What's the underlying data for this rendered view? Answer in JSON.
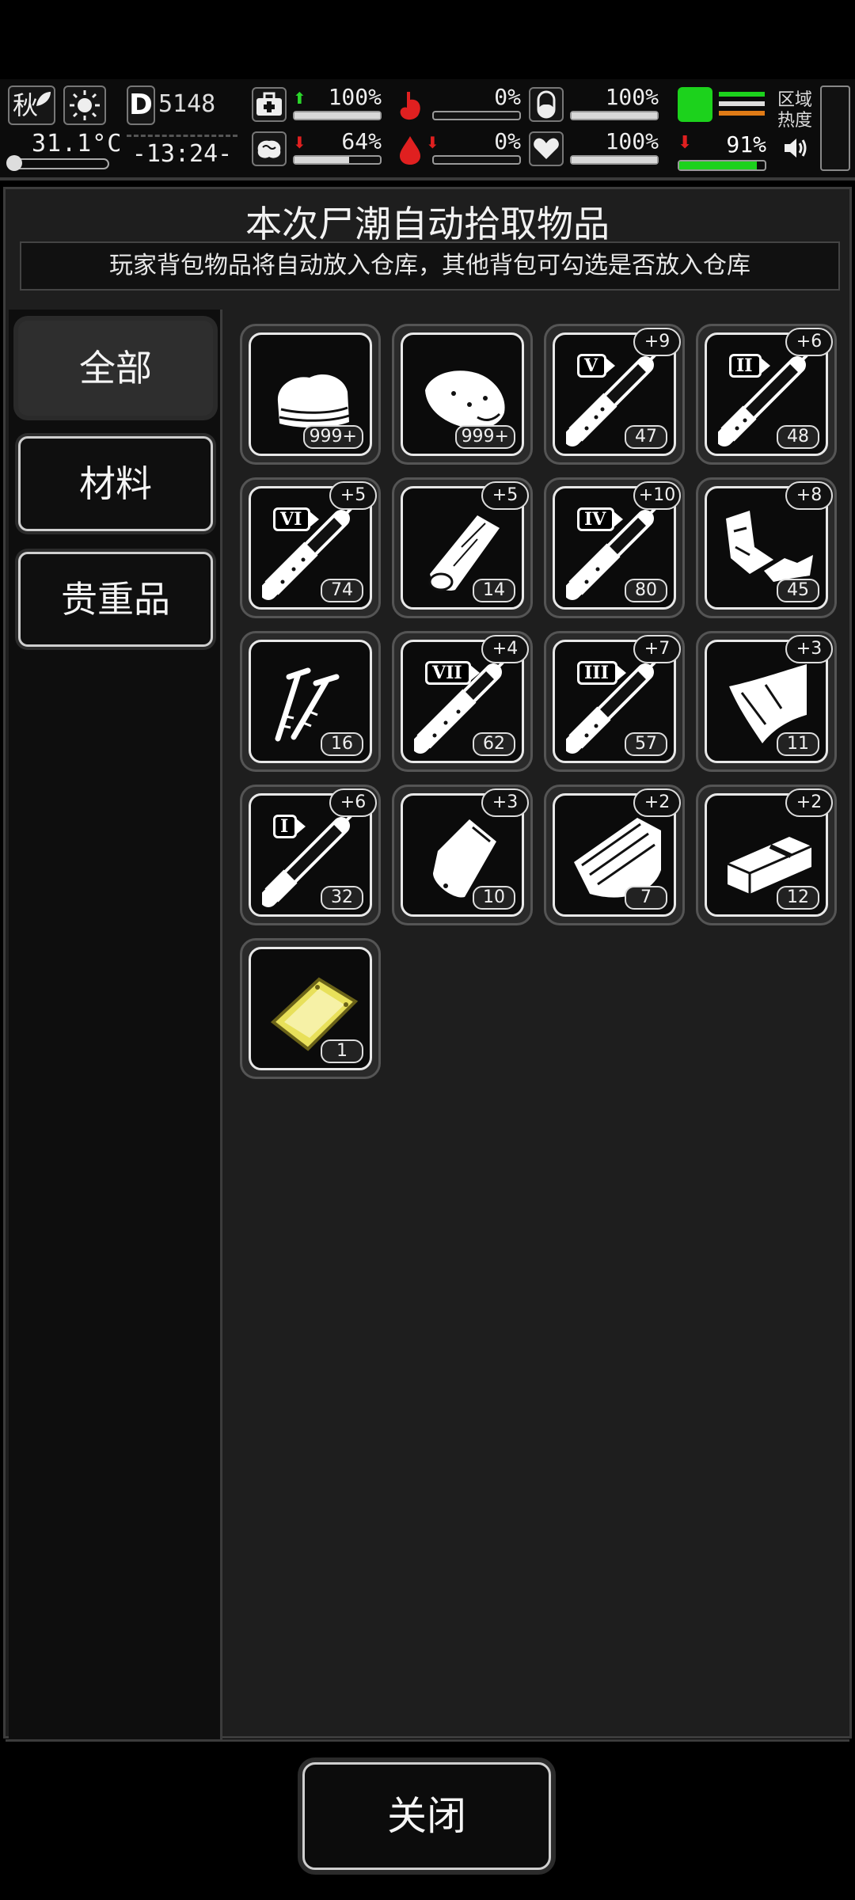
{
  "status": {
    "season": "秋",
    "temperature": "31.1°C",
    "day": "5148",
    "day_prefix": "D",
    "time": "-13:24-",
    "stats": [
      {
        "name": "health",
        "icon": "medkit-icon",
        "trend": "up",
        "value": "100%",
        "fill": 1.0
      },
      {
        "name": "hunger",
        "icon": "stomach-icon",
        "trend": "none",
        "value": "0%",
        "fill": 0.0
      },
      {
        "name": "fatigue",
        "icon": "pill-icon",
        "trend": "none",
        "value": "100%",
        "fill": 1.0
      },
      {
        "name": "mental",
        "icon": "brain-icon",
        "trend": "down",
        "value": "64%",
        "fill": 0.64
      },
      {
        "name": "bleeding",
        "icon": "blood-drop-icon",
        "trend": "down",
        "value": "0%",
        "fill": 0.0
      },
      {
        "name": "mood",
        "icon": "heart-icon",
        "trend": "none",
        "value": "100%",
        "fill": 1.0
      }
    ],
    "weather": {
      "trend": "down",
      "value": "91%",
      "fill": 0.91
    },
    "region_label_1": "区域",
    "region_label_2": "热度"
  },
  "panel": {
    "title": "本次尸潮自动拾取物品",
    "subtitle": "玩家背包物品将自动放入仓库，其他背包可勾选是否放入仓库",
    "tabs": [
      {
        "label": "全部",
        "active": true
      },
      {
        "label": "材料",
        "active": false
      },
      {
        "label": "贵重品",
        "active": false
      }
    ],
    "items": [
      {
        "icon": "cloth-icon",
        "count": "999+",
        "bonus": ""
      },
      {
        "icon": "meat-icon",
        "count": "999+",
        "bonus": ""
      },
      {
        "icon": "syringe-v-icon",
        "roman": "V",
        "count": "47",
        "bonus": "+9"
      },
      {
        "icon": "syringe-ii-icon",
        "roman": "II",
        "count": "48",
        "bonus": "+6"
      },
      {
        "icon": "syringe-vi-icon",
        "roman": "VI",
        "count": "74",
        "bonus": "+5"
      },
      {
        "icon": "wood-plank-icon",
        "count": "14",
        "bonus": "+5"
      },
      {
        "icon": "syringe-iv-icon",
        "roman": "IV",
        "count": "80",
        "bonus": "+10"
      },
      {
        "icon": "scrap-metal-icon",
        "count": "45",
        "bonus": "+8"
      },
      {
        "icon": "screws-icon",
        "count": "16",
        "bonus": ""
      },
      {
        "icon": "syringe-vii-icon",
        "roman": "VII",
        "count": "62",
        "bonus": "+4"
      },
      {
        "icon": "syringe-iii-icon",
        "roman": "III",
        "count": "57",
        "bonus": "+7"
      },
      {
        "icon": "iron-sheet-icon",
        "count": "11",
        "bonus": "+3"
      },
      {
        "icon": "syringe-i-icon",
        "roman": "I",
        "count": "32",
        "bonus": "+6"
      },
      {
        "icon": "plastic-bag-icon",
        "count": "10",
        "bonus": "+3"
      },
      {
        "icon": "lumber-icon",
        "count": "7",
        "bonus": "+2"
      },
      {
        "icon": "brick-icon",
        "count": "12",
        "bonus": "+2"
      },
      {
        "icon": "gold-bar-icon",
        "count": "1",
        "bonus": ""
      }
    ],
    "close_label": "关闭"
  },
  "colors": {
    "accent_green": "#1cd21c",
    "alert_red": "#e02020",
    "gold": "#e8e05a"
  }
}
